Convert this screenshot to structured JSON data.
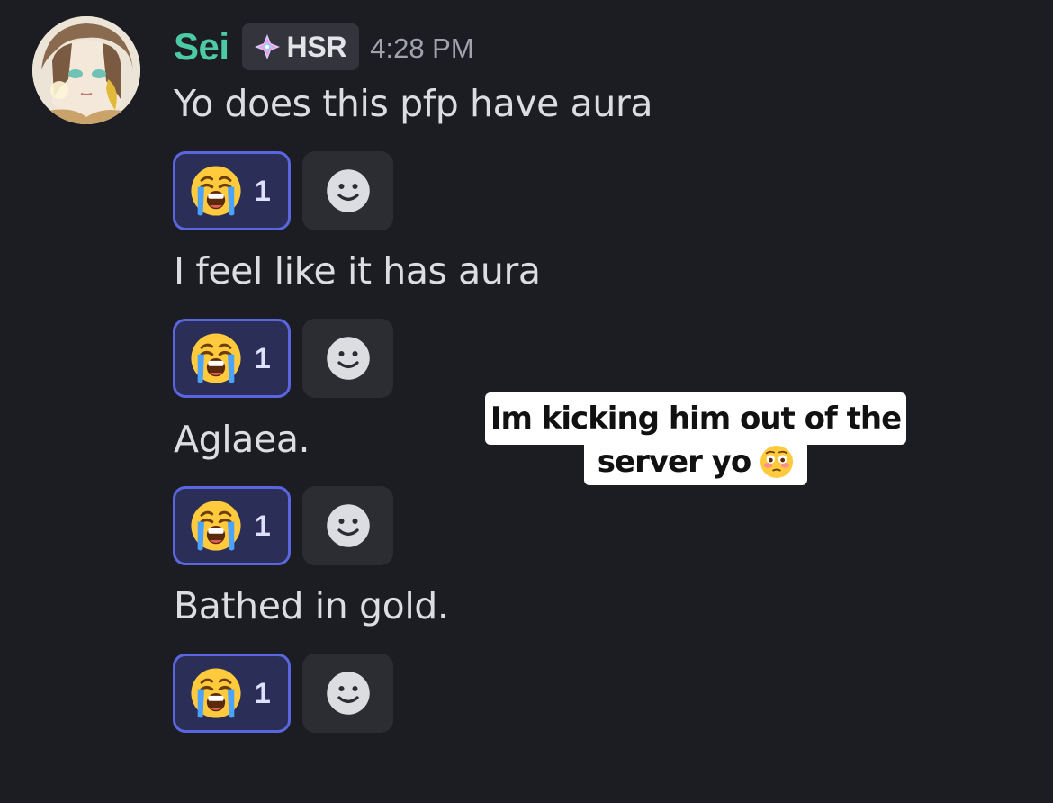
{
  "message": {
    "author": {
      "name": "Sei",
      "name_color": "#4cc9a5",
      "avatar": "anime-character-avatar"
    },
    "server_tag": {
      "icon": "diamond-sparkle-icon",
      "label": "HSR"
    },
    "timestamp": "4:28 PM",
    "lines": [
      {
        "text": "Yo does this pfp have aura",
        "reaction": {
          "emoji": "loudly-crying-face",
          "count": "1",
          "reacted_by_me": true
        }
      },
      {
        "text": "I feel like it has aura",
        "reaction": {
          "emoji": "loudly-crying-face",
          "count": "1",
          "reacted_by_me": true
        }
      },
      {
        "text": "Aglaea.",
        "reaction": {
          "emoji": "loudly-crying-face",
          "count": "1",
          "reacted_by_me": true
        }
      },
      {
        "text": "Bathed in gold.",
        "reaction": {
          "emoji": "loudly-crying-face",
          "count": "1",
          "reacted_by_me": true
        }
      }
    ],
    "add_reaction_icon": "smiley-face-icon"
  },
  "overlay_caption": {
    "line1": "Im kicking him out of the",
    "line2": "server yo",
    "emoji": "flushed-face"
  },
  "colors": {
    "background": "#1c1d22",
    "reaction_border": "#5a66e0",
    "reaction_fill": "#2b2f57"
  }
}
